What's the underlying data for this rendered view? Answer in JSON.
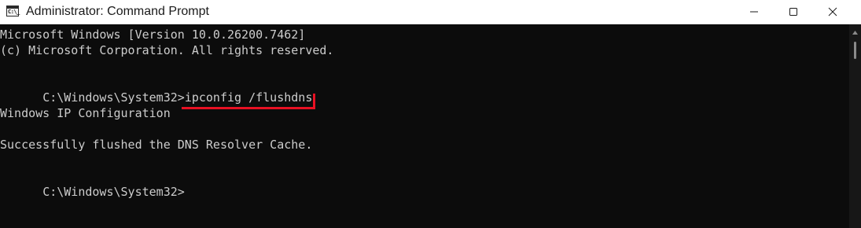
{
  "window": {
    "title": "Administrator: Command Prompt",
    "icon": "cmd-icon",
    "icon_glyph": "C:\\_",
    "controls": [
      "minimize-icon",
      "maximize-icon",
      "close-icon"
    ]
  },
  "console": {
    "lines": [
      {
        "text": "Microsoft Windows [Version 10.0.26200.7462]"
      },
      {
        "text": "(c) Microsoft Corporation. All rights reserved."
      },
      {
        "text": ""
      },
      {
        "prompt": "C:\\Windows\\System32>",
        "command": "ipconfig /flushdns",
        "highlighted": true
      },
      {
        "text": ""
      },
      {
        "text": "Windows IP Configuration"
      },
      {
        "text": ""
      },
      {
        "text": "Successfully flushed the DNS Resolver Cache."
      },
      {
        "text": ""
      },
      {
        "prompt": "C:\\Windows\\System32>",
        "command": ""
      }
    ]
  },
  "colors": {
    "console_background": "#0c0c0c",
    "console_text": "#cccccc",
    "titlebar_background": "#ffffff",
    "highlight": "#e81123"
  }
}
